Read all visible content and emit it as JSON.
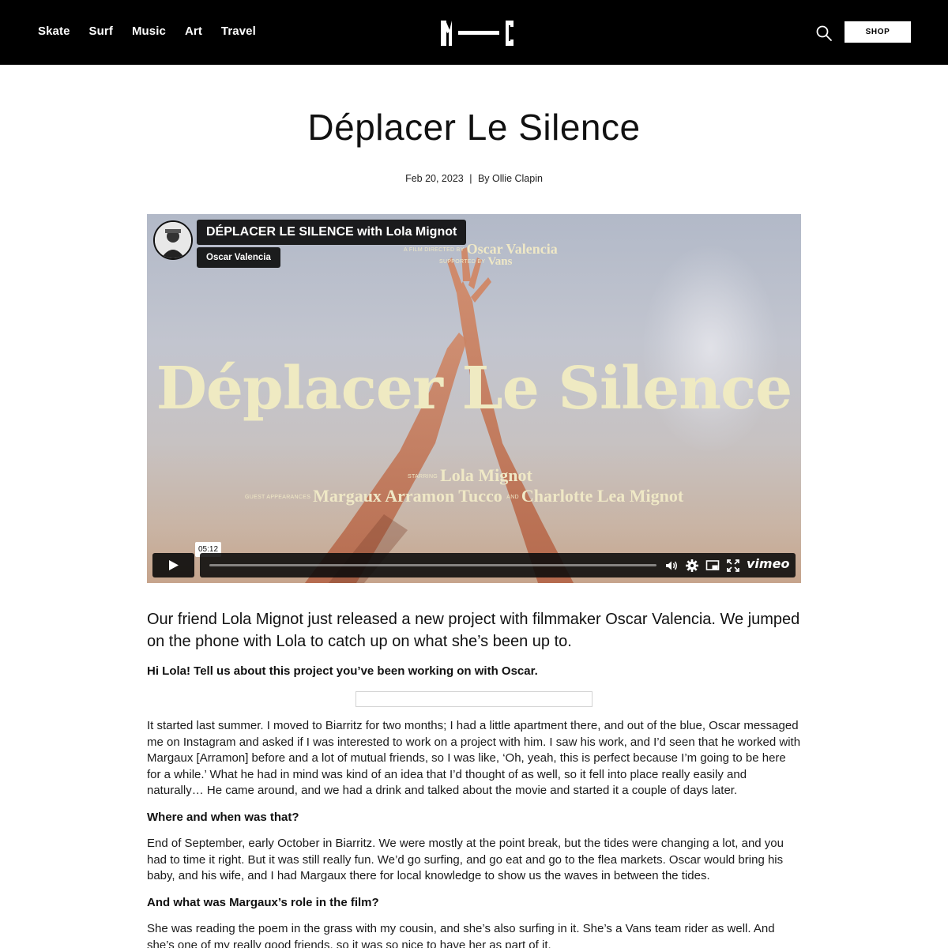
{
  "header": {
    "nav": [
      "Skate",
      "Surf",
      "Music",
      "Art",
      "Travel"
    ],
    "shop_label": "SHOP"
  },
  "article": {
    "title": "Déplacer Le Silence",
    "date": "Feb 20, 2023",
    "separator": "|",
    "byline": "By Ollie Clapin"
  },
  "video": {
    "title": "DÉPLACER LE SILENCE with Lola Mignot",
    "author": "Oscar Valencia",
    "time": "05:12",
    "poster_title": "Déplacer Le Silence",
    "credit_directed_prefix": "A FILM DIRECTED BY",
    "credit_directed": "Oscar Valencia",
    "credit_supported_prefix": "SUPPORTED BY",
    "credit_supported": "Vans",
    "starring_prefix": "STARRING",
    "starring": "Lola Mignot",
    "guest_prefix": "GUEST APPEARANCES",
    "guest_1": "Margaux Arramon Tucco",
    "and": "AND",
    "guest_2": "Charlotte Lea Mignot",
    "brand": "vimeo",
    "progress": 0
  },
  "body": {
    "lead": "Our friend Lola Mignot just released a new project with filmmaker Oscar Valencia. We jumped on the phone with Lola to catch up on what she’s been up to.",
    "q1": "Hi Lola! Tell us about this project you’ve been working on with Oscar.",
    "a1": "It started last summer. I moved to Biarritz for two months; I had a little apartment there, and out of the blue, Oscar messaged me on Instagram and asked if I was interested to work on a project with him. I saw his work, and I’d seen that he worked with Margaux [Arramon] before and a lot of mutual friends, so I was like, ‘Oh, yeah, this is perfect because I’m going to be here for a while.’ What he had in mind was kind of an idea that I’d thought of as well, so it fell into place really easily and naturally… He came around, and we had a drink and talked about the movie and started it a couple of days later.",
    "q2": "Where and when was that?",
    "a2": "End of September, early October in Biarritz. We were mostly at the point break, but the tides were changing a lot, and you had to time it right. But it was still really fun. We’d go surfing, and go eat and go to the flea markets. Oscar would bring his baby, and his wife, and I had Margaux there for local knowledge to show us the waves in between the tides.",
    "q3": "And what was Margaux’s role in the film?",
    "a3": "She was reading the poem in the grass with my cousin, and she’s also surfing in it. She’s a Vans team rider as well. And she’s one of my really good friends, so it was so nice to have her as part of it."
  }
}
